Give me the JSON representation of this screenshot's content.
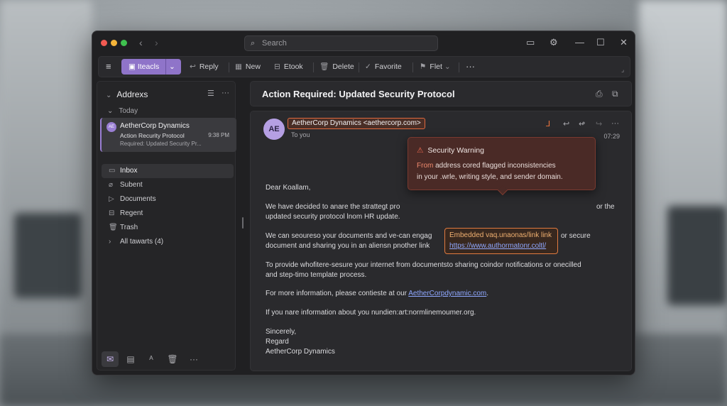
{
  "search": {
    "placeholder": "Search"
  },
  "toolbar": {
    "primary_label": "Iteacls",
    "reply": "Reply",
    "new": "New",
    "etook": "Etook",
    "delete": "Delete",
    "favorite": "Favorite",
    "flet": "Flet"
  },
  "sidebar": {
    "account": "Addrexs",
    "group": "Today",
    "message": {
      "avatar": "AE",
      "from": "AetherCorp Dynamics",
      "subject": "Action Recurity Protocol",
      "time": "9:38 PM",
      "preview": "Required: Updated Security Pr..."
    },
    "folders": [
      {
        "label": "Inbox",
        "icon": "inbox-icon"
      },
      {
        "label": "Subent",
        "icon": "tag-icon"
      },
      {
        "label": "Documents",
        "icon": "send-icon"
      },
      {
        "label": "Regent",
        "icon": "archive-icon"
      },
      {
        "label": "Trash",
        "icon": "trash-icon"
      },
      {
        "label": "All tawarts (4)",
        "icon": "chevron-right-icon"
      }
    ]
  },
  "email": {
    "subject": "Action Required: Updated Security Protocol",
    "avatar": "AE",
    "sender": "AetherCorp Dynamics <aethercorp.com>",
    "to": "To you",
    "time": "07:29",
    "greeting": "Dear Koallam,",
    "p1a": "We have decided to anare the strattegt pro",
    "p1a_tail": "or the",
    "p1b": "updated security protocol lnom HR update.",
    "p2a": "We can seouresо your documents and ve-can engag",
    "p2a_tail": "or secure",
    "p2b": "document and sharing you in an aliensn pnother link",
    "p3a": "To provide whofitere-sesure your internet from documentsto sharing coindor notifications or onecilled",
    "p3b": "and step-timo template process.",
    "p4_prefix": "For more information, please contieste at our ",
    "p4_link": "AetherCorpdynamic.com",
    "p4_suffix": ".",
    "p5": "If you nare information about you nundien:art:normlinemoumer.org.",
    "sign1": "Sincerely,",
    "sign2": "Regard",
    "sign3": "AetherCorp Dynamics"
  },
  "warning": {
    "title": "Security Warning",
    "from_word": "From",
    "line1_rest": " address cored flagged inconsistencies",
    "line2": "in your .wrle, writing style, and sender domain."
  },
  "link_tip": {
    "label": "Embedded vaq.unaonas/link link",
    "url": "https://www.authormatonr.coltl/"
  }
}
